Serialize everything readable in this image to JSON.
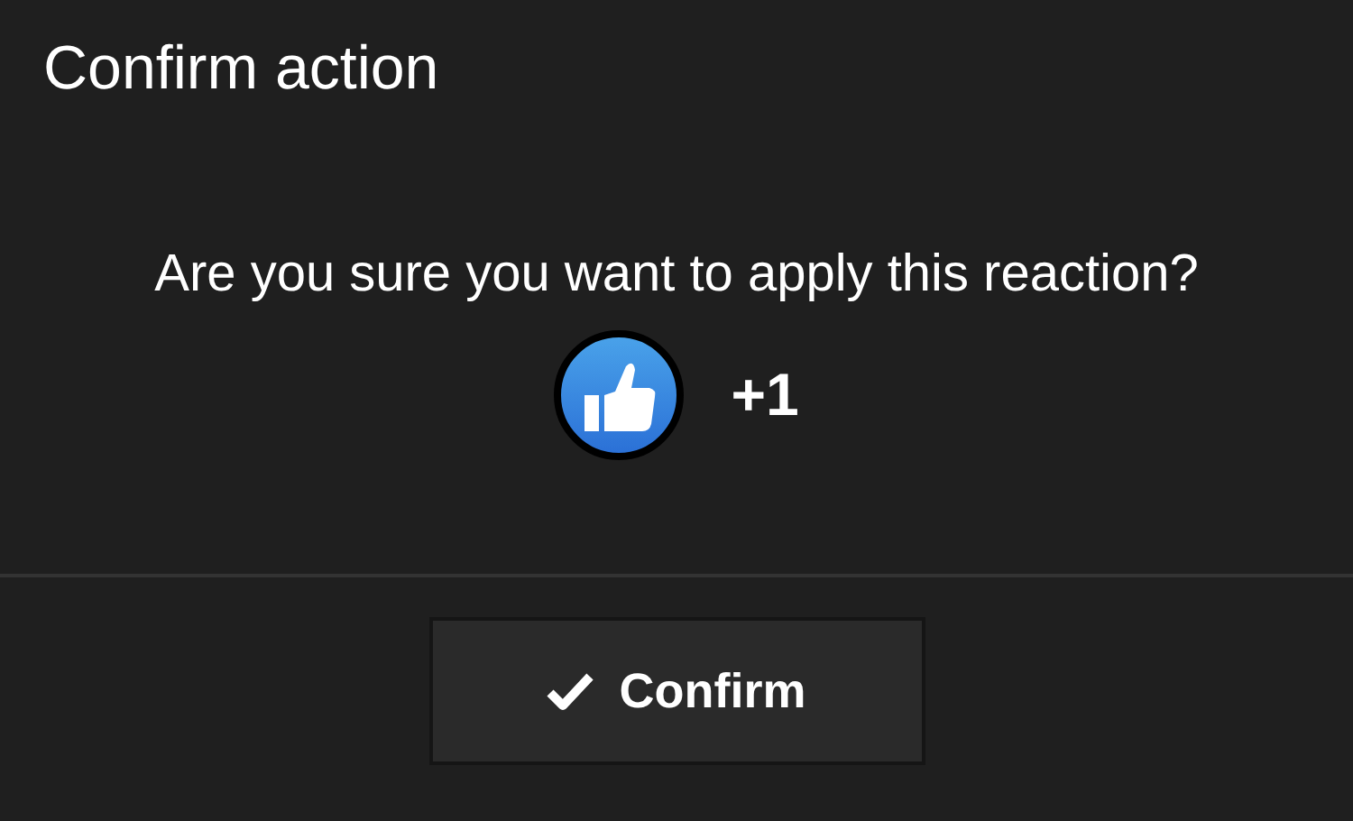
{
  "dialog": {
    "title": "Confirm action"
  },
  "message": "Are you sure you want to apply this reaction?",
  "reaction": {
    "label": "+1"
  },
  "buttons": [
    {
      "label": "Confirm"
    }
  ]
}
